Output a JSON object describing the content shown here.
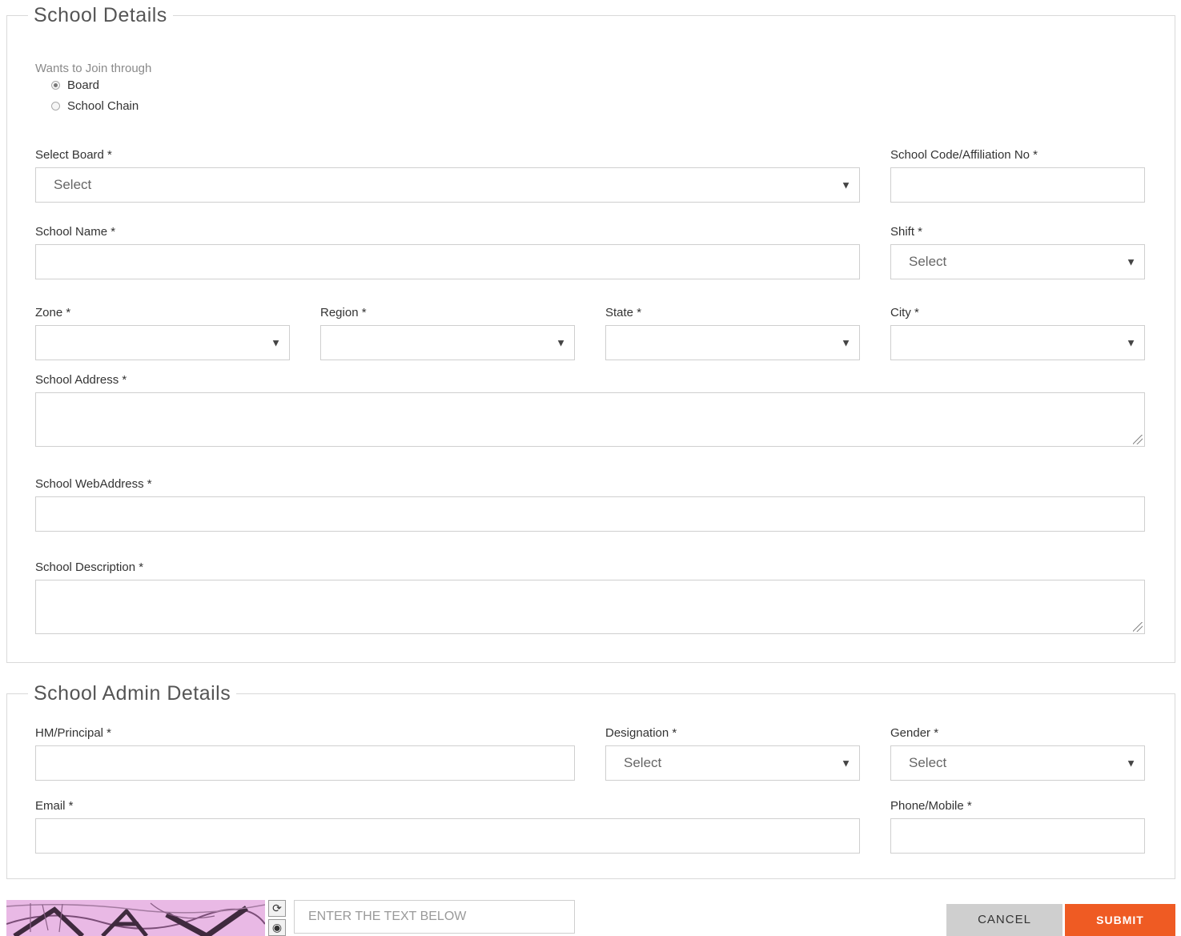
{
  "school_details": {
    "legend": "School Details",
    "join_through": {
      "label": "Wants to Join through",
      "options": [
        "Board",
        "School Chain"
      ],
      "selected": "Board"
    },
    "select_board": {
      "label": "Select Board *",
      "placeholder": "Select"
    },
    "school_code": {
      "label": "School Code/Affiliation No *",
      "value": ""
    },
    "school_name": {
      "label": "School Name *",
      "value": ""
    },
    "shift": {
      "label": "Shift *",
      "placeholder": "Select"
    },
    "zone": {
      "label": "Zone *",
      "value": ""
    },
    "region": {
      "label": "Region *",
      "value": ""
    },
    "state": {
      "label": "State *",
      "value": ""
    },
    "city": {
      "label": "City *",
      "value": ""
    },
    "school_address": {
      "label": "School Address *",
      "value": ""
    },
    "school_web_address": {
      "label": "School WebAddress *",
      "value": ""
    },
    "school_description": {
      "label": "School Description *",
      "value": ""
    }
  },
  "school_admin_details": {
    "legend": "School Admin Details",
    "hm_principal": {
      "label": "HM/Principal *",
      "value": ""
    },
    "designation": {
      "label": "Designation *",
      "placeholder": "Select"
    },
    "gender": {
      "label": "Gender *",
      "placeholder": "Select"
    },
    "email": {
      "label": "Email *",
      "value": ""
    },
    "phone": {
      "label": "Phone/Mobile *",
      "value": ""
    }
  },
  "captcha": {
    "input_placeholder": "ENTER THE TEXT BELOW",
    "refresh_icon": "refresh-icon",
    "audio_icon": "audio-icon"
  },
  "actions": {
    "cancel_label": "CANCEL",
    "submit_label": "SUBMIT"
  },
  "icons": {
    "dropdown": "▼",
    "refresh": "⟳",
    "audio": "◉"
  },
  "colors": {
    "submit_bg": "#ef5b23",
    "cancel_bg": "#cfcfcf",
    "border": "#cfcfcf"
  }
}
